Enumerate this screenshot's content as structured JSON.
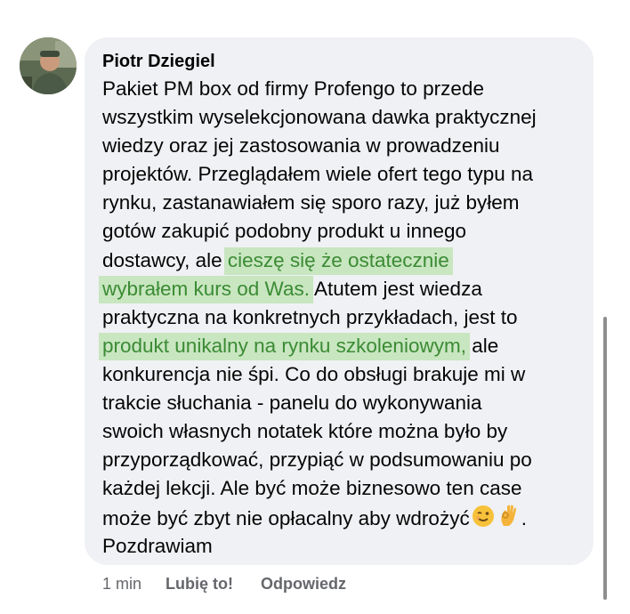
{
  "comment": {
    "author": "Piotr Dziegiel",
    "lines": {
      "l1": "Pakiet PM box od firmy Profengo to przede",
      "l2": "wszystkim wyselekcjonowana dawka praktycznej",
      "l3": "wiedzy oraz jej zastosowania w prowadzeniu",
      "l4": "projektów. Przeglądałem wiele ofert tego typu na",
      "l5": "rynku, zastanawiałem się sporo razy, już byłem",
      "l6": "gotów zakupić podobny produkt u innego",
      "l7a": "dostawcy, ale ",
      "l7b": "cieszę się że ostatecznie",
      "l8a": "wybrałem kurs od Was.",
      "l8b": " Atutem jest wiedza",
      "l9": "praktyczna na konkretnych przykładach, jest to",
      "l10a": "produkt unikalny na rynku szkoleniowym,",
      "l10b": " ale",
      "l11": "konkurencja nie śpi. Co do obsługi brakuje mi w",
      "l12": "trakcie słuchania - panelu do wykonywania",
      "l13": "swoich własnych notatek które można było by",
      "l14": "przyporządkować, przypiąć w podsumowaniu po",
      "l15": "każdej lekcji. Ale być może biznesowo ten case",
      "l16a": "może być zbyt nie opłacalny aby wdrożyć",
      "l16b": ".",
      "l17": "Pozdrawiam"
    },
    "emojis": [
      "winking-face",
      "ok-hand"
    ],
    "highlight_color": "#c8e6c0",
    "highlight_text_color": "#3b8b34"
  },
  "footer": {
    "time": "1 min",
    "like_label": "Lubię to!",
    "reply_label": "Odpowiedz"
  }
}
